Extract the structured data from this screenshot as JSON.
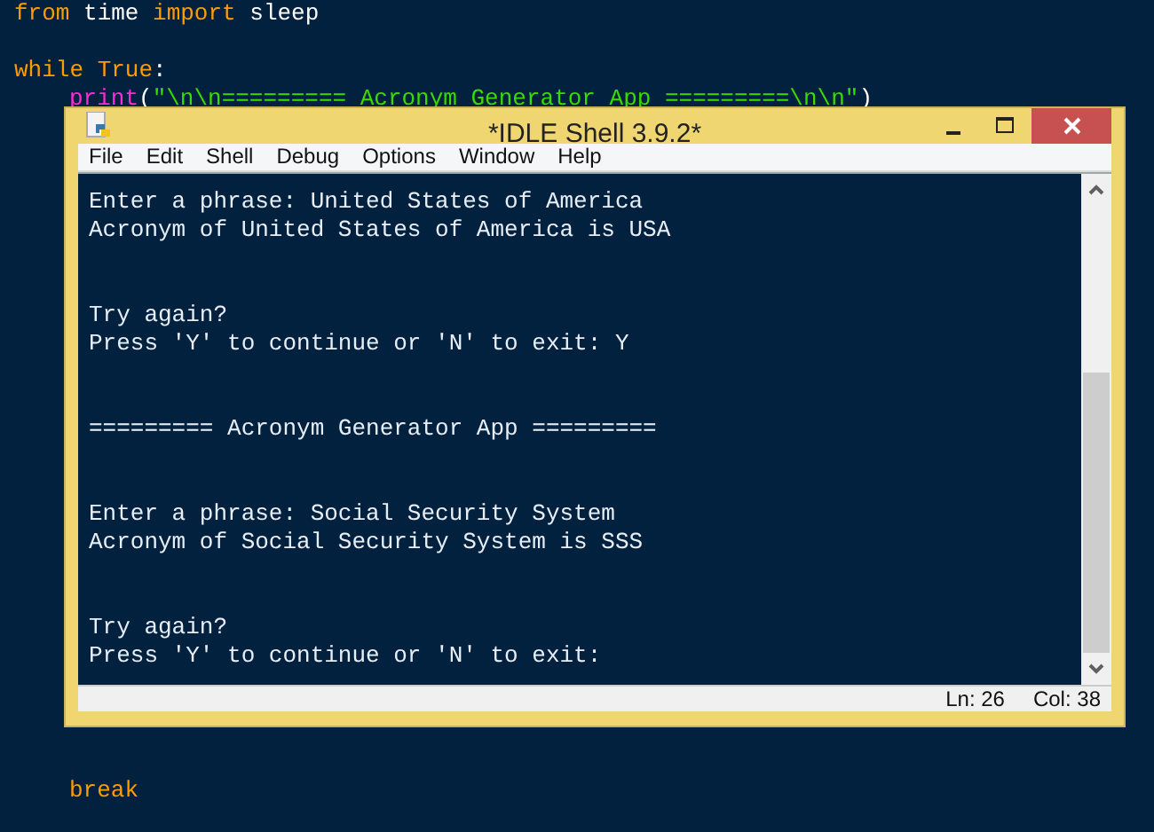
{
  "editor": {
    "lines": [
      {
        "tokens": [
          {
            "kind": "keyword",
            "text": "from"
          },
          {
            "kind": "plain",
            "text": " time "
          },
          {
            "kind": "keyword",
            "text": "import"
          },
          {
            "kind": "plain",
            "text": " sleep"
          }
        ]
      },
      {
        "tokens": [
          {
            "kind": "keyword",
            "text": "while"
          },
          {
            "kind": "keyword",
            "text": " True"
          },
          {
            "kind": "plain",
            "text": ":"
          }
        ],
        "children": [
          {
            "tokens": [
              {
                "kind": "builtin",
                "text": "print"
              },
              {
                "kind": "plain",
                "text": "("
              },
              {
                "kind": "string",
                "text": "\"\\n\\n========= Acronym Generator App =========\\n\\n\""
              },
              {
                "kind": "plain",
                "text": ")"
              }
            ]
          },
          {
            "tokens": [
              {
                "kind": "keyword",
                "text": "break"
              }
            ]
          }
        ]
      }
    ]
  },
  "window": {
    "title": "*IDLE Shell 3.9.2*",
    "menu": [
      "File",
      "Edit",
      "Shell",
      "Debug",
      "Options",
      "Window",
      "Help"
    ],
    "shell_blocks": [
      [
        "Enter a phrase: United States of America",
        "Acronym of United States of America is USA"
      ],
      [
        "Try again?",
        "Press 'Y' to continue or 'N' to exit: Y"
      ],
      [
        "========= Acronym Generator App ========="
      ],
      [
        "Enter a phrase: Social Security System",
        "Acronym of Social Security System is SSS"
      ],
      [
        "Try again?",
        "Press 'Y' to continue or 'N' to exit:"
      ]
    ],
    "status": [
      "Ln: 26",
      "Col: 38"
    ]
  }
}
